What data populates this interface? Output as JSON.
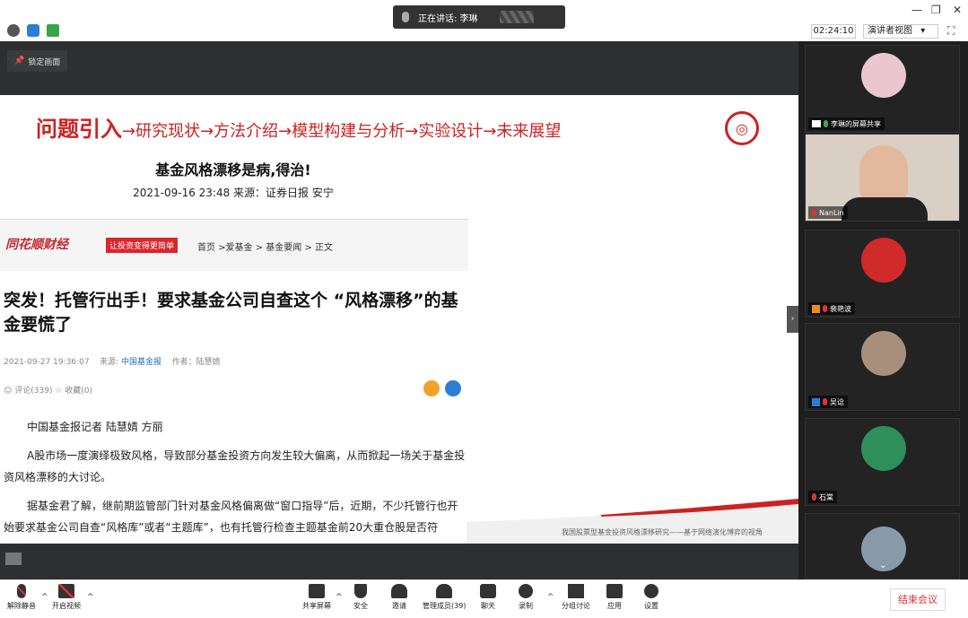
{
  "speaking": {
    "label": "正在讲话: 李琳"
  },
  "window": {
    "minimize": "—",
    "restore": "❐",
    "close": "✕"
  },
  "timer": "02:24:10",
  "view_button": "演讲者视图",
  "view_caret": "▾",
  "fullscreen_icon": "⛶",
  "pin_label": "锁定画面",
  "slide": {
    "header_main": "问题引入",
    "header_rest": "→研究现状→方法介绍→模型构建与分析→实验设计→未来展望",
    "article_title": "基金风格漂移是病,得治!",
    "article_meta": "2021-09-16 23:48  来源：证券日报  安宁",
    "ths_logo": "同花顺财经",
    "ths_tag": "让投资变得更简单",
    "breadcrumb": "首页 >爱基金 > 基金要闻 > 正文",
    "big_title": "突发！托管行出手！要求基金公司自查这个 “风格漂移”的基金要慌了",
    "meta2_date": "2021-09-27 19:36:07",
    "meta2_source_label": "来源:",
    "meta2_source": "中国基金报",
    "meta2_author": "作者：陆慧婧",
    "comments": "评论(339)",
    "favorites": "收藏(0)",
    "paragraphs": [
      "中国基金报记者 陆慧婧 方丽",
      "A股市场一度演绎极致风格，导致部分基金投资方向发生较大偏离，从而掀起一场关于基金投资风格漂移的大讨论。",
      "据基金君了解，继前期监管部门针对基金风格偏离做“窗口指导”后，近期，不少托管行也开始要求基金公司自查“风格库”或者“主题库”，也有托管行检查主题基金前20大重仓股是否符"
    ],
    "footnote": "我国股票型基金投资风格漂移研究——基于网络演化博弈的视角"
  },
  "participants": [
    {
      "name": "李琳的屏幕共享",
      "avatar_color": "#e9c6d0"
    },
    {
      "name": "NanLin",
      "avatar_color": "#c9b9a4"
    },
    {
      "name": "裴艳波",
      "avatar_color": "#d02a2a"
    },
    {
      "name": "吴谂",
      "avatar_color": "#a88f7c"
    },
    {
      "name": "石棠",
      "avatar_color": "#2f8f5a"
    },
    {
      "name": "",
      "avatar_color": "#8899aa"
    }
  ],
  "toolbar": {
    "unmute": "解除静音",
    "start_video": "开启视频",
    "share": "共享屏幕",
    "security": "安全",
    "invite": "邀请",
    "participants": "管理成员(39)",
    "chat": "聊天",
    "record": "录制",
    "breakout": "分组讨论",
    "apps": "应用",
    "settings": "设置",
    "end": "结束会议"
  },
  "colors": {
    "accent_red": "#c22222",
    "mute_red": "#d33333"
  }
}
